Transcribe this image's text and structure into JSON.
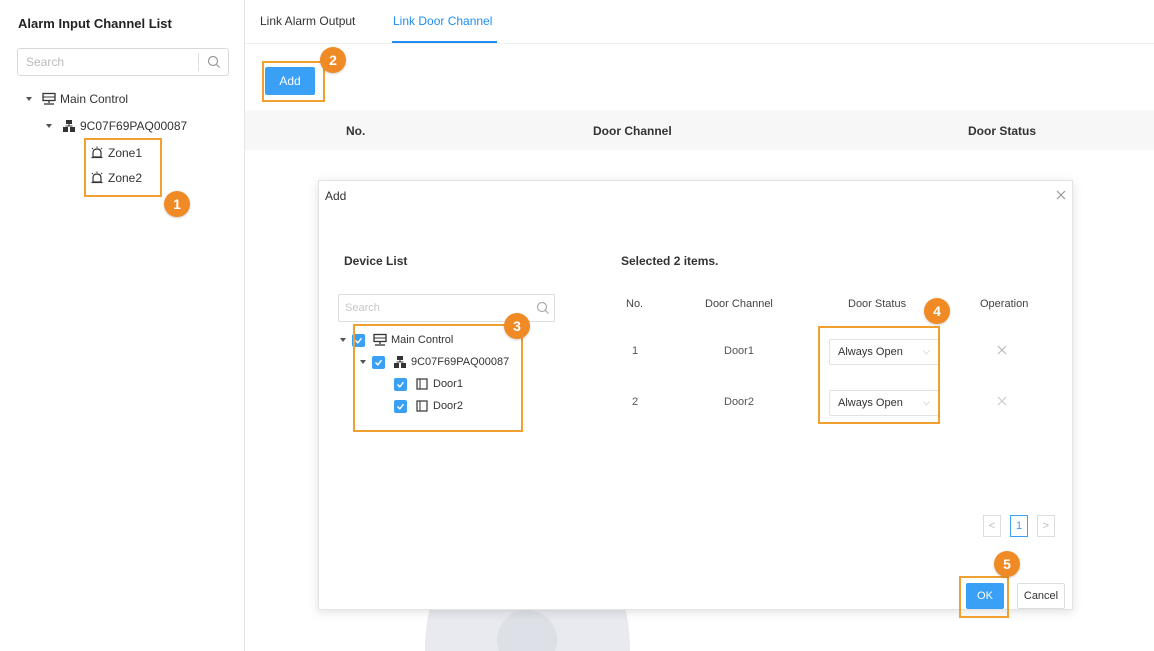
{
  "sidebar": {
    "title": "Alarm Input Channel List",
    "search_placeholder": "Search",
    "tree": {
      "root": "Main Control",
      "device": "9C07F69PAQ00087",
      "zones": [
        "Zone1",
        "Zone2"
      ]
    }
  },
  "tabs": [
    {
      "label": "Link Alarm Output",
      "active": false
    },
    {
      "label": "Link Door Channel",
      "active": true
    }
  ],
  "toolbar": {
    "add_label": "Add"
  },
  "table": {
    "columns": [
      "No.",
      "Door Channel",
      "Door Status"
    ]
  },
  "dialog": {
    "title": "Add",
    "device_list_label": "Device List",
    "selected_label": "Selected 2 items.",
    "search_placeholder": "Search",
    "tree": {
      "root": "Main Control",
      "device": "9C07F69PAQ00087",
      "doors": [
        "Door1",
        "Door2"
      ]
    },
    "columns": [
      "No.",
      "Door Channel",
      "Door Status",
      "Operation"
    ],
    "rows": [
      {
        "no": "1",
        "channel": "Door1",
        "status": "Always Open"
      },
      {
        "no": "2",
        "channel": "Door2",
        "status": "Always Open"
      }
    ],
    "pagination": {
      "prev": "<",
      "current": "1",
      "next": ">"
    },
    "ok_label": "OK",
    "cancel_label": "Cancel"
  },
  "steps": [
    "1",
    "2",
    "3",
    "4",
    "5"
  ],
  "colors": {
    "accent": "#3aa0f5",
    "highlight": "#f0a030",
    "badge": "#f08a24"
  }
}
